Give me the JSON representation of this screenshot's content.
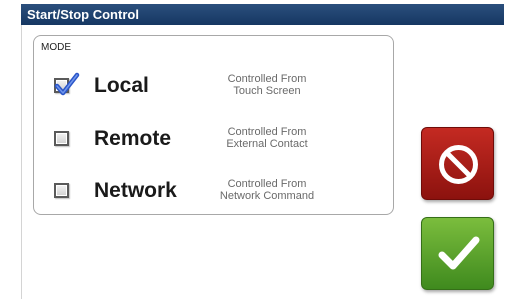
{
  "window": {
    "title": "Start/Stop Control"
  },
  "mode_panel": {
    "heading": "MODE",
    "options": [
      {
        "label": "Local",
        "desc_line1": "Controlled From",
        "desc_line2": "Touch Screen",
        "checked": true
      },
      {
        "label": "Remote",
        "desc_line1": "Controlled From",
        "desc_line2": "External Contact",
        "checked": false
      },
      {
        "label": "Network",
        "desc_line1": "Controlled From",
        "desc_line2": "Network Command",
        "checked": false
      }
    ]
  },
  "buttons": {
    "stop_icon": "prohibited-icon",
    "confirm_icon": "checkmark-icon"
  },
  "colors": {
    "title_bar": "#1d4170",
    "stop_button": "#b0201a",
    "confirm_button": "#5ea62d",
    "checkmark": "#2a55c8"
  }
}
